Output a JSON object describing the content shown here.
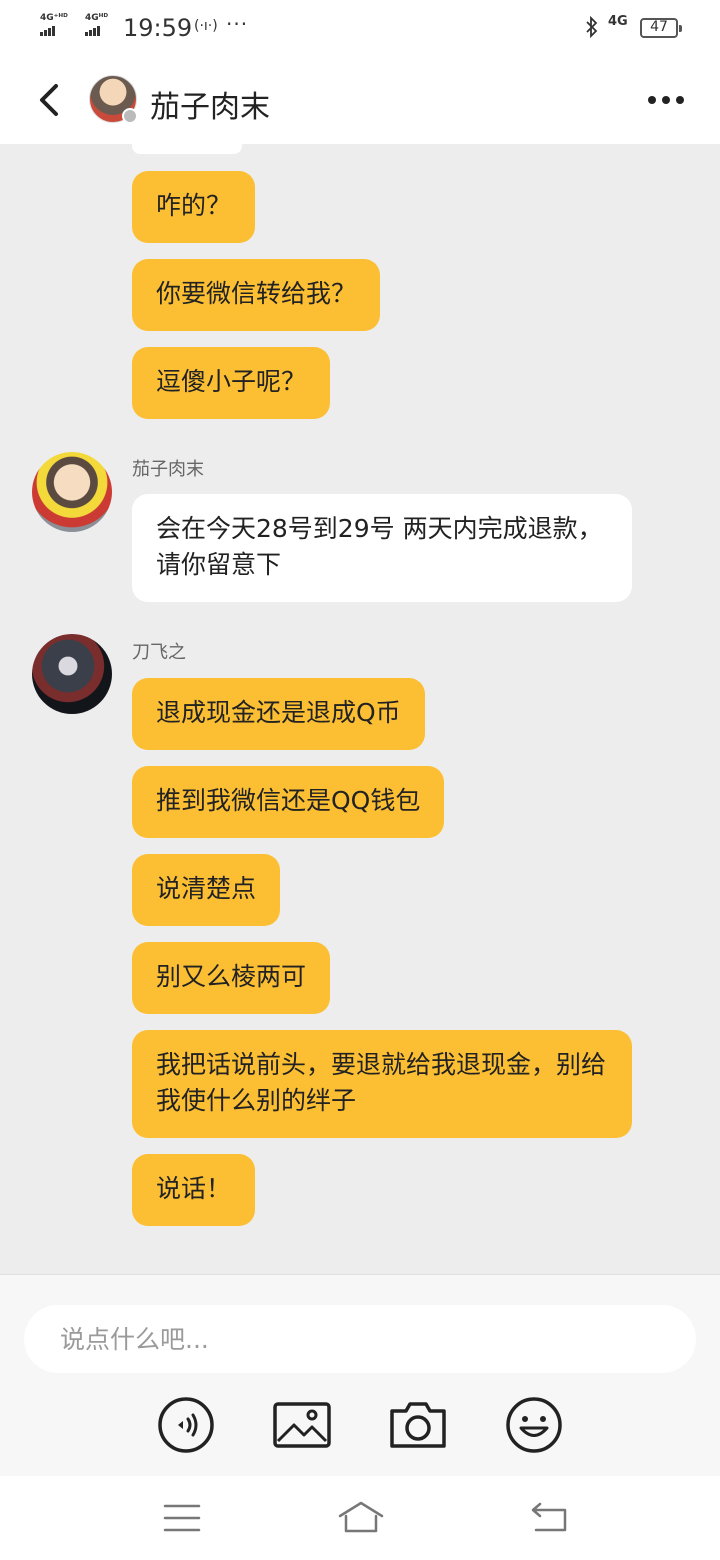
{
  "status_bar": {
    "net1": "4G⁺ᴴᴰ",
    "net2": "4Gᴴᴰ",
    "time": "19:59",
    "hotspot": "(·ı·)",
    "more": "···",
    "network_right": "4G",
    "battery": "47"
  },
  "header": {
    "title": "茄子肉末"
  },
  "messages": [
    {
      "text": "咋的？"
    },
    {
      "text": "你要微信转给我？"
    },
    {
      "text": "逗傻小子呢？"
    },
    {
      "sender": "茄子肉末",
      "text": "会在今天28号到29号 两天内完成退款，请你留意下"
    },
    {
      "sender": "刀飞之",
      "text": "退成现金还是退成Q币"
    },
    {
      "text": "推到我微信还是QQ钱包"
    },
    {
      "text": "说清楚点"
    },
    {
      "text": "别又么棱两可"
    },
    {
      "text": "我把话说前头，要退就给我退现金，别给我使什么别的绊子"
    },
    {
      "text": "说话！"
    }
  ],
  "input": {
    "placeholder": "说点什么吧..."
  },
  "colors": {
    "bubble_self": "#fcbf34",
    "bubble_other": "#ffffff",
    "chat_background": "#ededed"
  },
  "icons": {
    "toolbar": [
      "voice-icon",
      "image-icon",
      "camera-icon",
      "emoji-icon"
    ],
    "navigation": [
      "menu-icon",
      "home-icon",
      "back-nav-icon"
    ]
  }
}
